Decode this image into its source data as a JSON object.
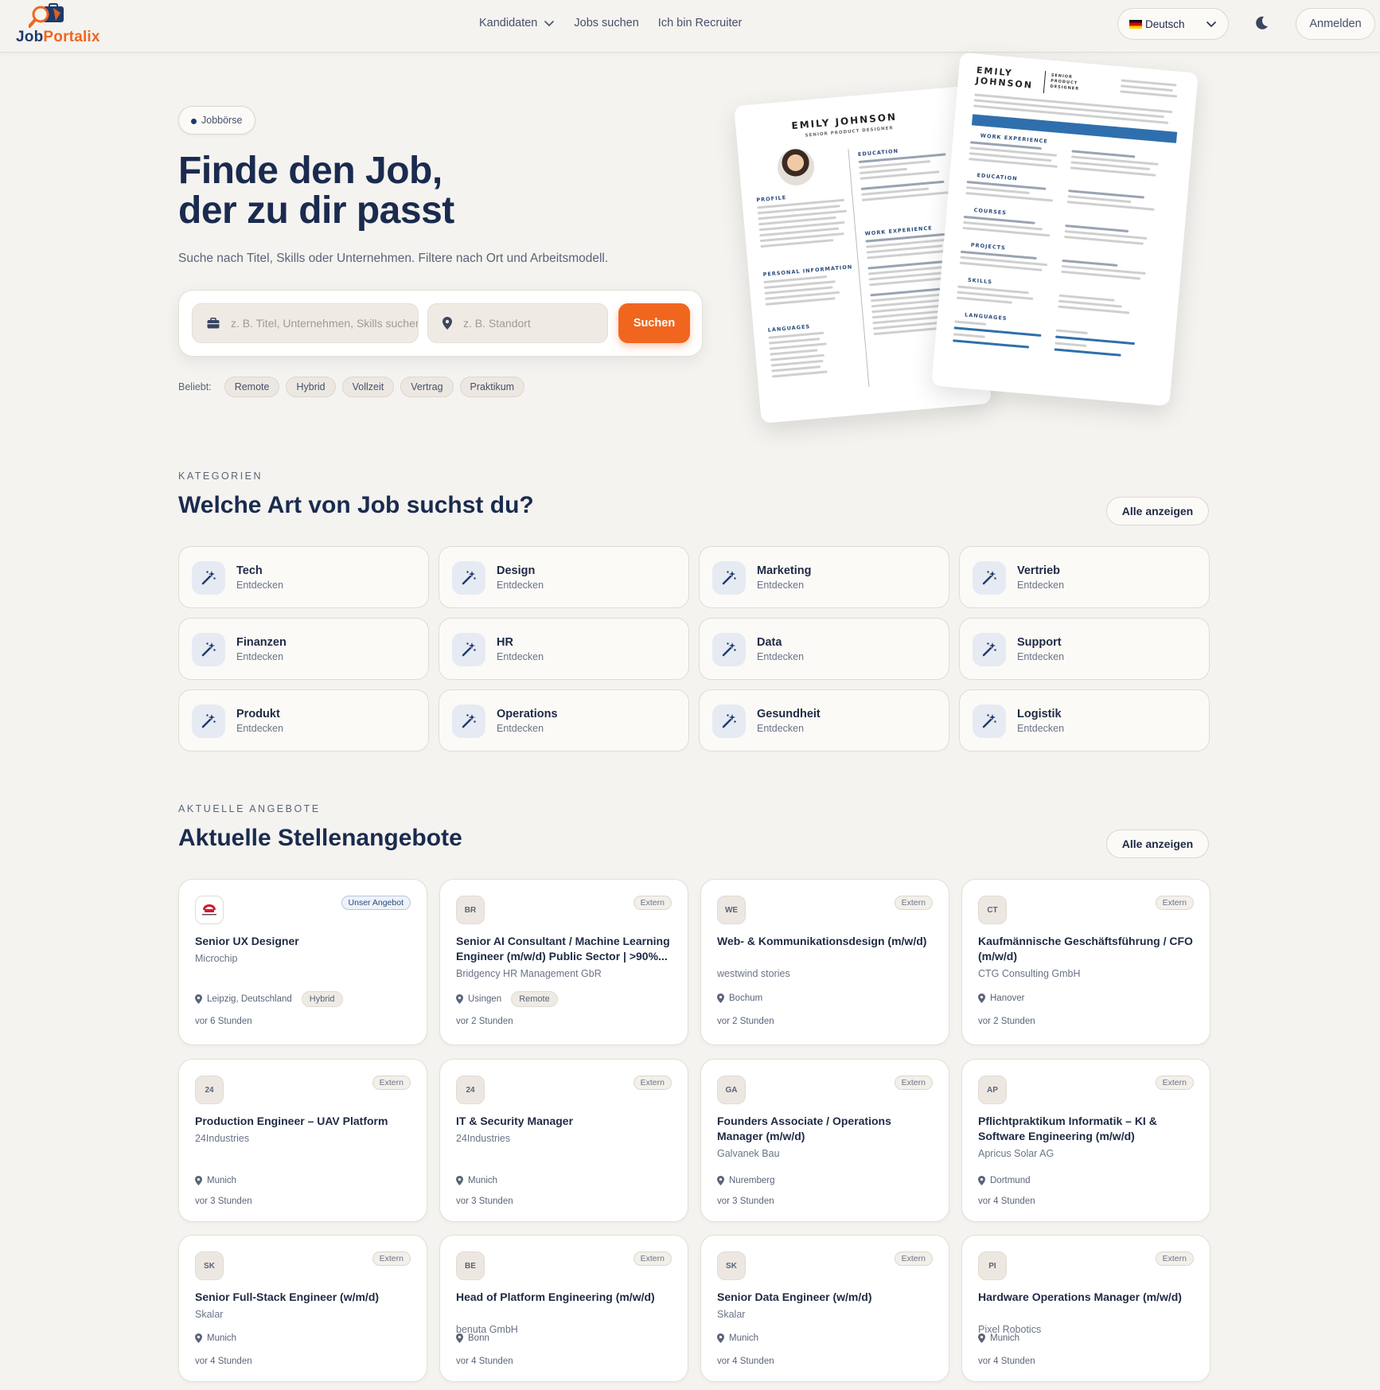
{
  "header": {
    "logo": {
      "part1": "Job",
      "part2": "Portalix"
    },
    "nav": [
      "Kandidaten",
      "Jobs suchen",
      "Ich bin Recruiter"
    ],
    "language": "Deutsch",
    "login": "Anmelden"
  },
  "hero": {
    "badge": "Jobbörse",
    "title_line1": "Finde den Job,",
    "title_line2": "der zu dir passt",
    "subtitle": "Suche nach Titel, Skills oder Unternehmen. Filtere nach Ort und Arbeitsmodell.",
    "search": {
      "query_placeholder": "z. B. Titel, Unternehmen, Skills suchen",
      "location_placeholder": "z. B. Standort",
      "button": "Suchen"
    },
    "popular_label": "Beliebt:",
    "popular_chips": [
      "Remote",
      "Hybrid",
      "Vollzeit",
      "Vertrag",
      "Praktikum"
    ]
  },
  "resume_back": {
    "name": "EMILY JOHNSON",
    "role": "SENIOR PRODUCT DESIGNER",
    "sections": [
      "PROFILE",
      "EDUCATION",
      "WORK EXPERIENCE",
      "PERSONAL INFORMATION",
      "LANGUAGES"
    ]
  },
  "resume_front": {
    "name_line1": "EMILY",
    "name_line2": "JOHNSON",
    "role": "SENIOR PRODUCT DESIGNER",
    "sections": [
      "WORK EXPERIENCE",
      "EDUCATION",
      "COURSES",
      "PROJECTS",
      "SKILLS",
      "LANGUAGES"
    ]
  },
  "categories": {
    "eyebrow": "KATEGORIEN",
    "title": "Welche Art von Job suchst du?",
    "see_all": "Alle anzeigen",
    "items": [
      {
        "name": "Tech",
        "sub": "Entdecken"
      },
      {
        "name": "Design",
        "sub": "Entdecken"
      },
      {
        "name": "Marketing",
        "sub": "Entdecken"
      },
      {
        "name": "Vertrieb",
        "sub": "Entdecken"
      },
      {
        "name": "Finanzen",
        "sub": "Entdecken"
      },
      {
        "name": "HR",
        "sub": "Entdecken"
      },
      {
        "name": "Data",
        "sub": "Entdecken"
      },
      {
        "name": "Support",
        "sub": "Entdecken"
      },
      {
        "name": "Produkt",
        "sub": "Entdecken"
      },
      {
        "name": "Operations",
        "sub": "Entdecken"
      },
      {
        "name": "Gesundheit",
        "sub": "Entdecken"
      },
      {
        "name": "Logistik",
        "sub": "Entdecken"
      }
    ]
  },
  "jobs": {
    "eyebrow": "AKTUELLE ANGEBOTE",
    "title": "Aktuelle Stellenangebote",
    "see_all": "Alle anzeigen",
    "items": [
      {
        "logo": "",
        "tag": "Unser Angebot",
        "title": "Senior UX Designer",
        "company": "Microchip",
        "location": "Leipzig, Deutschland",
        "mode": "Hybrid",
        "time": "vor 6 Stunden"
      },
      {
        "logo": "BR",
        "tag": "Extern",
        "title": "Senior AI Consultant / Machine Learning Engineer (m/w/d) Public Sector | >90%...",
        "company": "Bridgency HR Management GbR",
        "location": "Usingen",
        "mode": "Remote",
        "time": "vor 2 Stunden"
      },
      {
        "logo": "WE",
        "tag": "Extern",
        "title": "Web- & Kommunikationsdesign (m/w/d)",
        "company": "westwind stories",
        "location": "Bochum",
        "mode": "",
        "time": "vor 2 Stunden"
      },
      {
        "logo": "CT",
        "tag": "Extern",
        "title": "Kaufmännische Geschäftsführung / CFO (m/w/d)",
        "company": "CTG Consulting GmbH",
        "location": "Hanover",
        "mode": "",
        "time": "vor 2 Stunden"
      },
      {
        "logo": "24",
        "tag": "Extern",
        "title": "Production Engineer – UAV Platform",
        "company": "24Industries",
        "location": "Munich",
        "mode": "",
        "time": "vor 3 Stunden"
      },
      {
        "logo": "24",
        "tag": "Extern",
        "title": "IT & Security Manager",
        "company": "24Industries",
        "location": "Munich",
        "mode": "",
        "time": "vor 3 Stunden"
      },
      {
        "logo": "GA",
        "tag": "Extern",
        "title": "Founders Associate / Operations Manager (m/w/d)",
        "company": "Galvanek Bau",
        "location": "Nuremberg",
        "mode": "",
        "time": "vor 3 Stunden"
      },
      {
        "logo": "AP",
        "tag": "Extern",
        "title": "Pflichtpraktikum Informatik – KI & Software Engineering (m/w/d)",
        "company": "Apricus Solar AG",
        "location": "Dortmund",
        "mode": "",
        "time": "vor 4 Stunden"
      },
      {
        "logo": "SK",
        "tag": "Extern",
        "title": "Senior Full-Stack Engineer (w/m/d)",
        "company": "Skalar",
        "location": "Munich",
        "mode": "",
        "time": "vor 4 Stunden"
      },
      {
        "logo": "BE",
        "tag": "Extern",
        "title": "Head of Platform Engineering (m/w/d)",
        "company": "benuta GmbH",
        "location": "Bonn",
        "mode": "",
        "time": "vor 4 Stunden"
      },
      {
        "logo": "SK",
        "tag": "Extern",
        "title": "Senior Data Engineer (w/m/d)",
        "company": "Skalar",
        "location": "Munich",
        "mode": "",
        "time": "vor 4 Stunden"
      },
      {
        "logo": "PI",
        "tag": "Extern",
        "title": "Hardware Operations Manager (m/w/d)",
        "company": "Pixel Robotics",
        "location": "Munich",
        "mode": "",
        "time": "vor 4 Stunden"
      }
    ]
  },
  "icons": {
    "category_icon": "magic-wand-icon",
    "location_icon": "map-pin-icon",
    "briefcase_icon": "briefcase-icon",
    "theme_icon": "moon-icon"
  },
  "colors": {
    "accent": "#f0661f",
    "brand_dark": "#1e3a6b",
    "background": "#f5f3ef"
  }
}
